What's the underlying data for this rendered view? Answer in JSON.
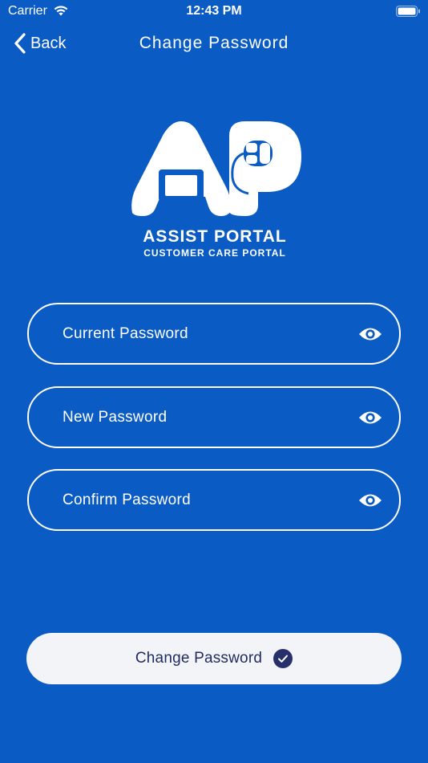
{
  "status_bar": {
    "carrier": "Carrier",
    "time": "12:43 PM"
  },
  "nav": {
    "back_label": "Back",
    "title": "Change Password"
  },
  "logo": {
    "title": "ASSIST PORTAL",
    "subtitle": "CUSTOMER CARE PORTAL"
  },
  "form": {
    "current_password": {
      "placeholder": "Current Password",
      "value": ""
    },
    "new_password": {
      "placeholder": "New Password",
      "value": ""
    },
    "confirm_password": {
      "placeholder": "Confirm Password",
      "value": ""
    },
    "submit_label": "Change Password"
  },
  "icons": {
    "wifi": "wifi-icon",
    "battery": "battery-icon",
    "back": "chevron-left-icon",
    "eye": "eye-icon",
    "check": "check-circle-icon"
  },
  "colors": {
    "background": "#0a5cc4",
    "button_bg": "#f3f4f7",
    "button_text": "#1f2b5e",
    "check_circle": "#27306a"
  }
}
